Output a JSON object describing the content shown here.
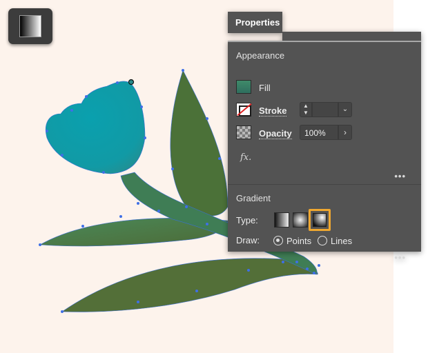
{
  "toolbar": {
    "tool_icon": "gradient-tool-icon"
  },
  "panel": {
    "tab_label": "Properties",
    "appearance": {
      "title": "Appearance",
      "fill_label": "Fill",
      "stroke_label": "Stroke",
      "opacity_label": "Opacity",
      "opacity_value": "100%",
      "fx_label": "fx.",
      "more_label": "•••"
    },
    "gradient": {
      "title": "Gradient",
      "type_label": "Type:",
      "draw_label": "Draw:",
      "types": [
        "linear-gradient-icon",
        "radial-gradient-icon",
        "freeform-gradient-icon"
      ],
      "selected_type": "freeform-gradient-icon",
      "draw_options": [
        "Points",
        "Lines"
      ],
      "selected_draw": "Points",
      "more_label": "•••"
    }
  },
  "colors": {
    "canvas_bg": "#fdf3ec",
    "panel_bg": "#535353",
    "selected_highlight": "#f0a830",
    "anchor_point": "#3f6fe6",
    "flower_teal": "#0a9aa8",
    "leaf_green": "#4a7a44"
  }
}
